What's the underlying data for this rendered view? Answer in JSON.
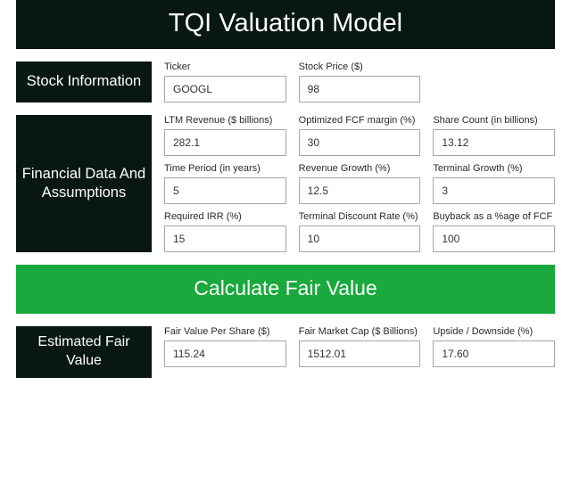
{
  "title": "TQI Valuation Model",
  "stock": {
    "section_label": "Stock Information",
    "ticker_label": "Ticker",
    "ticker_value": "GOOGL",
    "price_label": "Stock Price ($)",
    "price_value": "98"
  },
  "assumptions": {
    "section_label": "Financial Data And Assumptions",
    "ltm_rev_label": "LTM Revenue ($ billions)",
    "ltm_rev_value": "282.1",
    "fcf_margin_label": "Optimized FCF margin (%)",
    "fcf_margin_value": "30",
    "share_count_label": "Share Count (in billions)",
    "share_count_value": "13.12",
    "period_label": "Time Period (in years)",
    "period_value": "5",
    "rev_growth_label": "Revenue Growth (%)",
    "rev_growth_value": "12.5",
    "term_growth_label": "Terminal Growth (%)",
    "term_growth_value": "3",
    "irr_label": "Required IRR (%)",
    "irr_value": "15",
    "term_disc_label": "Terminal Discount Rate (%)",
    "term_disc_value": "10",
    "buyback_label": "Buyback as a %age of FCF",
    "buyback_value": "100"
  },
  "calc_button": "Calculate Fair Value",
  "result": {
    "section_label": "Estimated Fair Value",
    "fvps_label": "Fair Value Per Share ($)",
    "fvps_value": "115.24",
    "fmc_label": "Fair Market Cap ($ Billions)",
    "fmc_value": "1512.01",
    "upside_label": "Upside / Downside (%)",
    "upside_value": "17.60"
  }
}
